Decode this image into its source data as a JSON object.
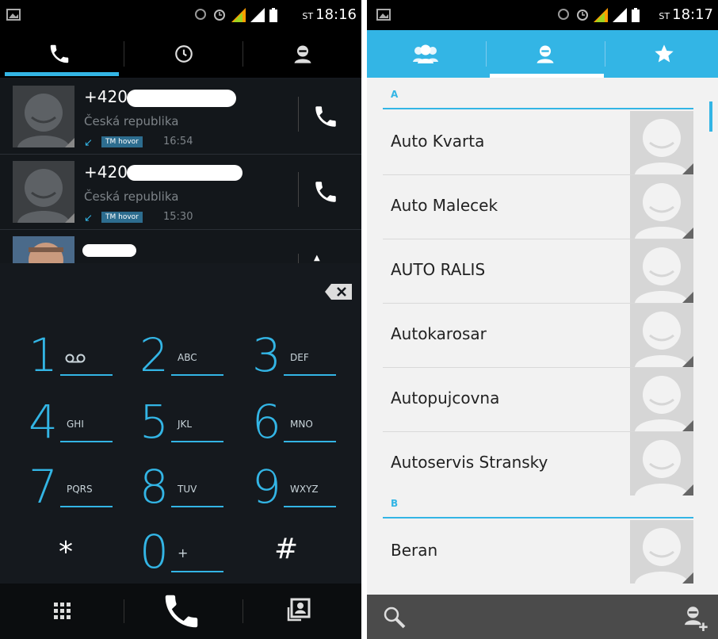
{
  "left": {
    "status_bar": {
      "carrier_mark": "ST",
      "time": "18:16"
    },
    "tabs": [
      {
        "id": "phone",
        "icon": "phone-icon",
        "selected": true
      },
      {
        "id": "recent",
        "icon": "clock-icon",
        "selected": false
      },
      {
        "id": "contacts",
        "icon": "person-icon",
        "selected": false
      }
    ],
    "calls": [
      {
        "number": "+420",
        "location": "Česká republika",
        "operator": "TM hovor",
        "time": "16:54",
        "type": "incoming"
      },
      {
        "number": "+420",
        "location": "Česká republika",
        "operator": "TM hovor",
        "time": "15:30",
        "type": "incoming"
      }
    ],
    "dialpad": [
      {
        "digit": "1",
        "letters": "QO"
      },
      {
        "digit": "2",
        "letters": "ABC"
      },
      {
        "digit": "3",
        "letters": "DEF"
      },
      {
        "digit": "4",
        "letters": "GHI"
      },
      {
        "digit": "5",
        "letters": "JKL"
      },
      {
        "digit": "6",
        "letters": "MNO"
      },
      {
        "digit": "7",
        "letters": "PQRS"
      },
      {
        "digit": "8",
        "letters": "TUV"
      },
      {
        "digit": "9",
        "letters": "WXYZ"
      },
      {
        "digit": "*",
        "letters": ""
      },
      {
        "digit": "0",
        "letters": "+"
      },
      {
        "digit": "#",
        "letters": ""
      }
    ],
    "accent": "#33b5e5"
  },
  "right": {
    "status_bar": {
      "carrier_mark": "ST",
      "time": "18:17"
    },
    "tabs": [
      {
        "id": "groups",
        "icon": "group-icon",
        "selected": false
      },
      {
        "id": "all",
        "icon": "person-icon",
        "selected": true
      },
      {
        "id": "favorites",
        "icon": "star-icon",
        "selected": false
      }
    ],
    "sections": [
      {
        "letter": "A",
        "contacts": [
          "Auto Kvarta",
          "Auto Malecek",
          "AUTO RALIS",
          "Autokarosar",
          "Autopujcovna",
          "Autoservis Stransky"
        ]
      },
      {
        "letter": "B",
        "contacts": [
          "Beran"
        ]
      }
    ]
  }
}
